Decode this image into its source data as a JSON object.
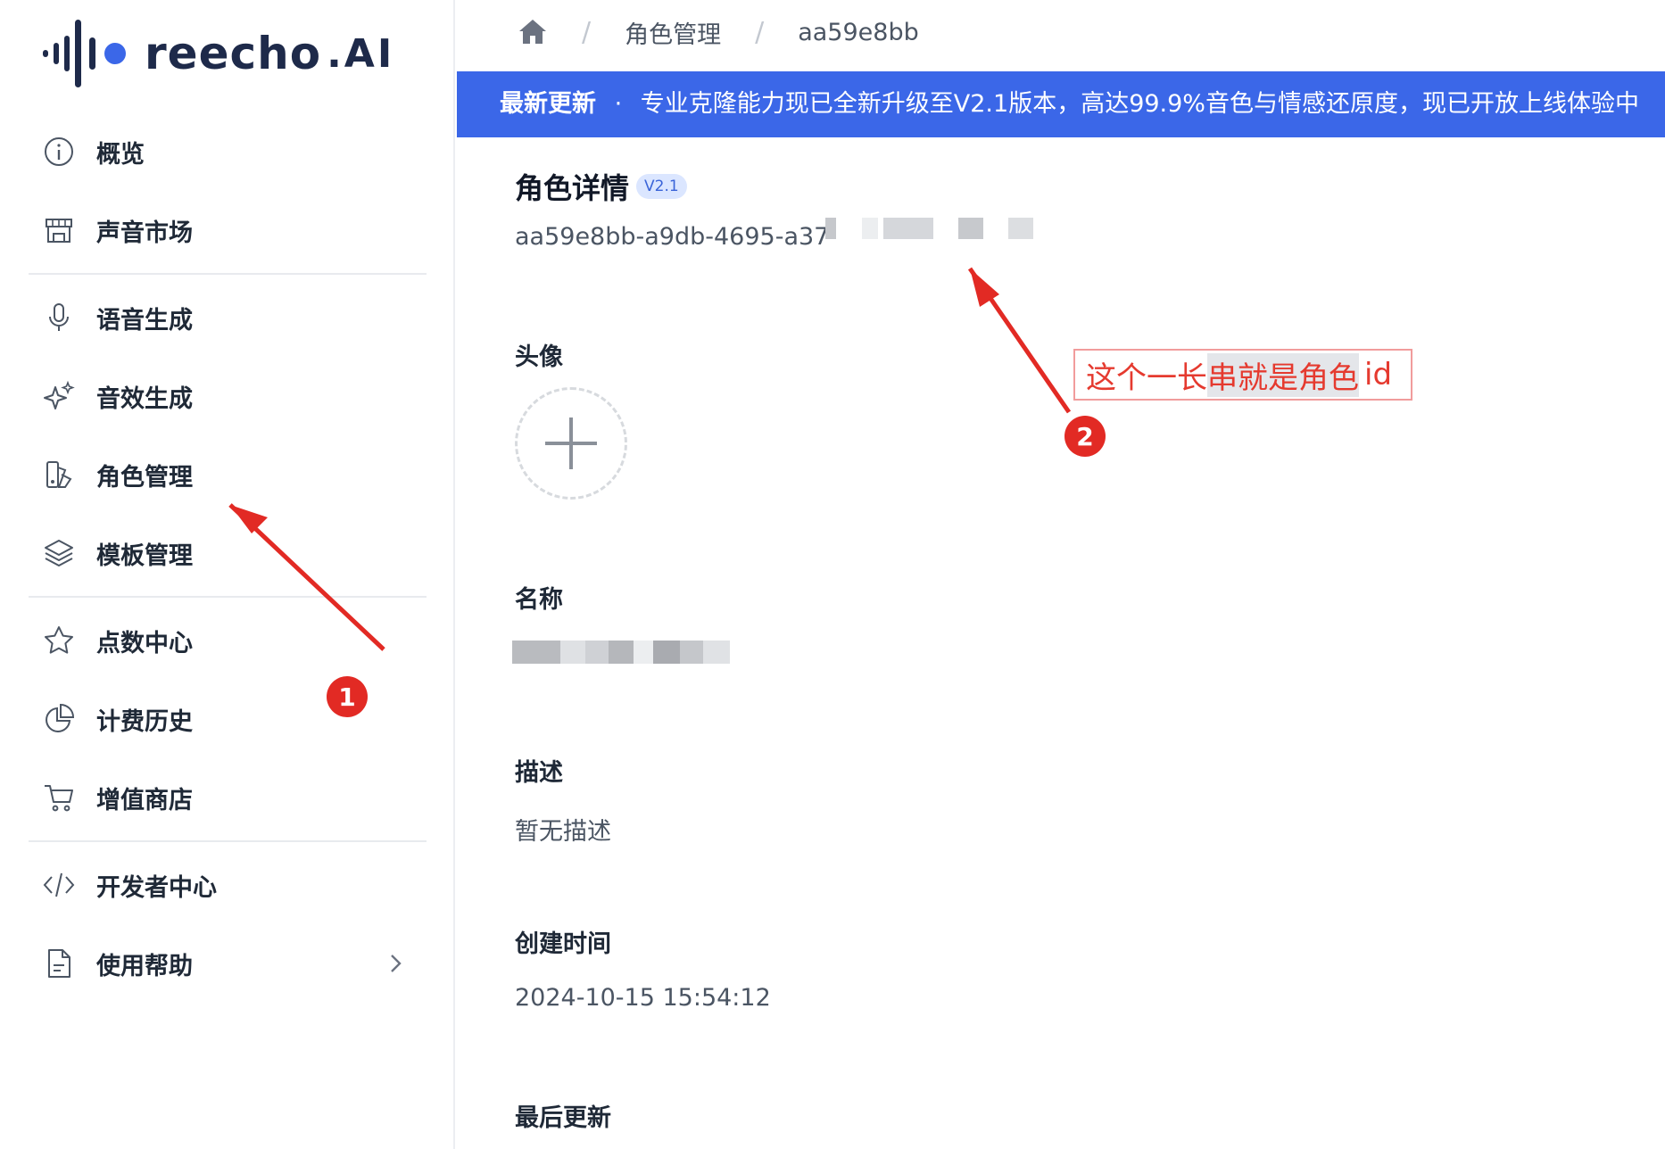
{
  "logo": {
    "text": "reecho",
    "suffix": ".AI"
  },
  "sidebar": {
    "items": [
      {
        "label": "概览",
        "icon": "info-icon"
      },
      {
        "label": "声音市场",
        "icon": "store-icon"
      },
      {
        "label": "语音生成",
        "icon": "microphone-icon"
      },
      {
        "label": "音效生成",
        "icon": "sparkle-icon"
      },
      {
        "label": "角色管理",
        "icon": "character-icon"
      },
      {
        "label": "模板管理",
        "icon": "layers-icon"
      },
      {
        "label": "点数中心",
        "icon": "star-icon"
      },
      {
        "label": "计费历史",
        "icon": "pie-chart-icon"
      },
      {
        "label": "增值商店",
        "icon": "cart-icon"
      },
      {
        "label": "开发者中心",
        "icon": "code-icon"
      },
      {
        "label": "使用帮助",
        "icon": "document-icon"
      }
    ]
  },
  "breadcrumb": {
    "home_icon": "home-icon",
    "section": "角色管理",
    "current": "aa59e8bb"
  },
  "banner": {
    "title": "最新更新",
    "separator": "·",
    "message": "专业克隆能力现已全新升级至V2.1版本，高达99.9%音色与情感还原度，现已开放上线体验中"
  },
  "detail": {
    "title": "角色详情",
    "version": "V2.1",
    "id_visible": "aa59e8bb-a9db-4695-a37",
    "avatar_label": "头像",
    "name_label": "名称",
    "description_label": "描述",
    "description_value": "暂无描述",
    "created_label": "创建时间",
    "created_value": "2024-10-15 15:54:12",
    "updated_label": "最后更新"
  },
  "annotations": {
    "callout_pre": "这个一长",
    "callout_highlight": "串就是角色",
    "callout_post": "id",
    "badge1": "1",
    "badge2": "2",
    "color": "#e22a24"
  },
  "colors": {
    "accent": "#3b67e8",
    "badge_bg": "#dbe6ff",
    "annotation": "#e53a2f"
  }
}
